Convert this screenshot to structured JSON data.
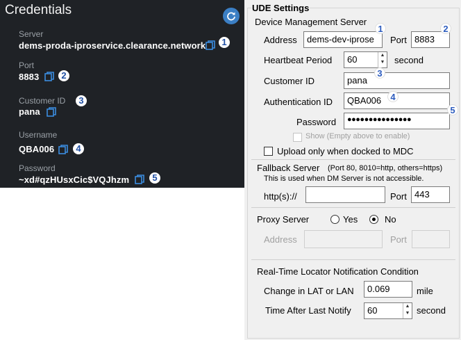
{
  "credentials": {
    "title": "Credentials",
    "refresh_icon": "refresh-icon",
    "copy_icon": "copy-icon",
    "fields": [
      {
        "label": "Server",
        "value": "dems-proda-iproservice.clearance.network",
        "badge": "1"
      },
      {
        "label": "Port",
        "value": "8883",
        "badge": "2"
      },
      {
        "label": "Customer ID",
        "value": "pana",
        "badge": "3"
      },
      {
        "label": "Username",
        "value": "QBA006",
        "badge": "4"
      },
      {
        "label": "Password",
        "value": "~xd#qzHUsxCic$VQJhzm",
        "badge": "5"
      }
    ]
  },
  "ude": {
    "title": "UDE Settings",
    "dms": {
      "heading": "Device Management Server",
      "address_label": "Address",
      "address_value": "dems-dev-iprose",
      "address_badge": "1",
      "port_label": "Port",
      "port_value": "8883",
      "port_badge": "2",
      "heartbeat_label": "Heartbeat Period",
      "heartbeat_value": "60",
      "heartbeat_unit": "second",
      "customer_label": "Customer ID",
      "customer_value": "pana",
      "customer_badge": "3",
      "auth_label": "Authentication ID",
      "auth_value": "QBA006",
      "auth_badge": "4",
      "password_label": "Password",
      "password_value": "●●●●●●●●●●●●●●●",
      "password_badge": "5",
      "show_label": "Show (Empty above to enable)",
      "upload_label": "Upload only when docked to MDC"
    },
    "fallback": {
      "heading": "Fallback Server",
      "note": "(Port 80, 8010=http, others=https)",
      "desc": "This is used when DM Server is not accessible.",
      "http_label": "http(s)://",
      "http_value": "",
      "port_label": "Port",
      "port_value": "443"
    },
    "proxy": {
      "heading": "Proxy Server",
      "yes_label": "Yes",
      "no_label": "No",
      "selected": "No",
      "address_label": "Address",
      "port_label": "Port"
    },
    "locator": {
      "heading": "Real-Time Locator  Notification Condition",
      "change_label": "Change in LAT or LAN",
      "change_value": "0.069",
      "change_unit": "mile",
      "time_label": "Time After Last Notify",
      "time_value": "60",
      "time_unit": "second"
    }
  }
}
